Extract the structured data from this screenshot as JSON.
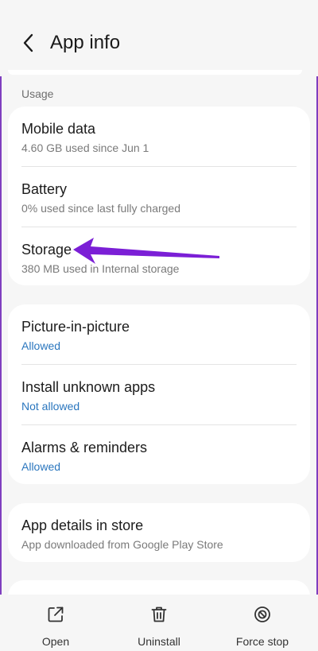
{
  "header": {
    "title": "App info",
    "back_icon": "chevron-left-icon"
  },
  "usage": {
    "section_label": "Usage",
    "items": [
      {
        "title": "Mobile data",
        "subtitle": "4.60 GB used since Jun 1"
      },
      {
        "title": "Battery",
        "subtitle": "0% used since last fully charged"
      },
      {
        "title": "Storage",
        "subtitle": "380 MB used in Internal storage"
      }
    ]
  },
  "permissions": {
    "items": [
      {
        "title": "Picture-in-picture",
        "status": "Allowed"
      },
      {
        "title": "Install unknown apps",
        "status": "Not allowed"
      },
      {
        "title": "Alarms & reminders",
        "status": "Allowed"
      }
    ]
  },
  "store": {
    "title": "App details in store",
    "subtitle": "App downloaded from Google Play Store"
  },
  "bottom_actions": [
    {
      "label": "Open",
      "icon": "open-external-icon"
    },
    {
      "label": "Uninstall",
      "icon": "trash-icon"
    },
    {
      "label": "Force stop",
      "icon": "block-icon"
    }
  ],
  "colors": {
    "background": "#f6f6f6",
    "card": "#ffffff",
    "status_blue": "#2a76be",
    "annotation_arrow": "#7b1fd6",
    "frame": "#7f3fbf"
  }
}
